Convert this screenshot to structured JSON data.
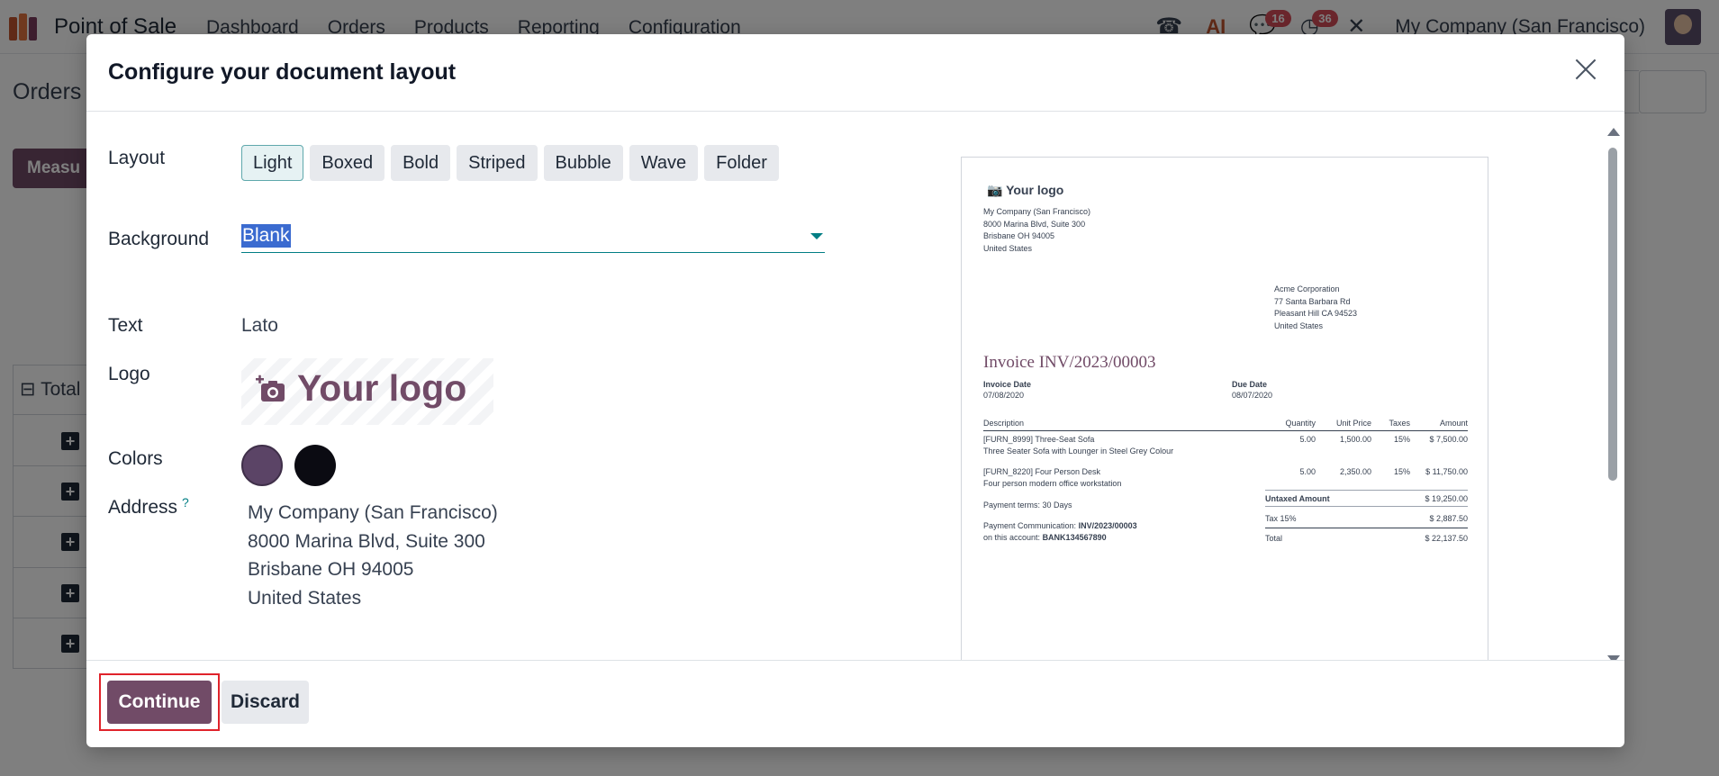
{
  "app": {
    "name": "Point of Sale",
    "nav": [
      "Dashboard",
      "Orders",
      "Products",
      "Reporting",
      "Configuration"
    ],
    "chat_badge": "16",
    "activity_badge": "36",
    "company": "My Company (San Francisco)"
  },
  "background_page": {
    "title": "Orders",
    "measures_button": "Measu",
    "total_label": "Total"
  },
  "modal": {
    "title": "Configure your document layout",
    "labels": {
      "layout": "Layout",
      "background": "Background",
      "text": "Text",
      "logo": "Logo",
      "colors": "Colors",
      "address": "Address",
      "address_help": "?"
    },
    "layout_options": [
      "Light",
      "Boxed",
      "Bold",
      "Striped",
      "Bubble",
      "Wave",
      "Folder"
    ],
    "layout_selected": "Light",
    "background_value": "Blank",
    "text_value": "Lato",
    "logo_placeholder": "Your logo",
    "colors": {
      "primary": "#5b4466",
      "secondary": "#0b0b12"
    },
    "address_lines": [
      "My Company (San Francisco)",
      "8000 Marina Blvd, Suite 300",
      "Brisbane OH 94005",
      "United States"
    ],
    "buttons": {
      "continue": "Continue",
      "discard": "Discard"
    }
  },
  "preview": {
    "logo_text": "Your logo",
    "company_address": [
      "My Company (San Francisco)",
      "8000 Marina Blvd, Suite 300",
      "Brisbane OH 94005",
      "United States"
    ],
    "customer_address": [
      "Acme Corporation",
      "77 Santa Barbara Rd",
      "Pleasant Hill CA 94523",
      "United States"
    ],
    "invoice_title": "Invoice INV/2023/00003",
    "invoice_date_label": "Invoice Date",
    "invoice_date": "07/08/2020",
    "due_date_label": "Due Date",
    "due_date": "08/07/2020",
    "table_headers": [
      "Description",
      "Quantity",
      "Unit Price",
      "Taxes",
      "Amount"
    ],
    "lines": [
      {
        "code": "[FURN_8999] Three-Seat Sofa",
        "desc": "Three Seater Sofa with Lounger in Steel Grey Colour",
        "qty": "5.00",
        "price": "1,500.00",
        "tax": "15%",
        "amount": "$ 7,500.00"
      },
      {
        "code": "[FURN_8220] Four Person Desk",
        "desc": "Four person modern office workstation",
        "qty": "5.00",
        "price": "2,350.00",
        "tax": "15%",
        "amount": "$ 11,750.00"
      }
    ],
    "payment_terms": "Payment terms: 30 Days",
    "payment_comm_label": "Payment Communication:",
    "payment_comm_ref": "INV/2023/00003",
    "account_label": "on this account:",
    "account_no": "BANK134567890",
    "untaxed_label": "Untaxed Amount",
    "untaxed_value": "$ 19,250.00",
    "tax_label": "Tax 15%",
    "tax_value": "$ 2,887.50",
    "total_label": "Total",
    "total_value": "$ 22,137.50"
  }
}
